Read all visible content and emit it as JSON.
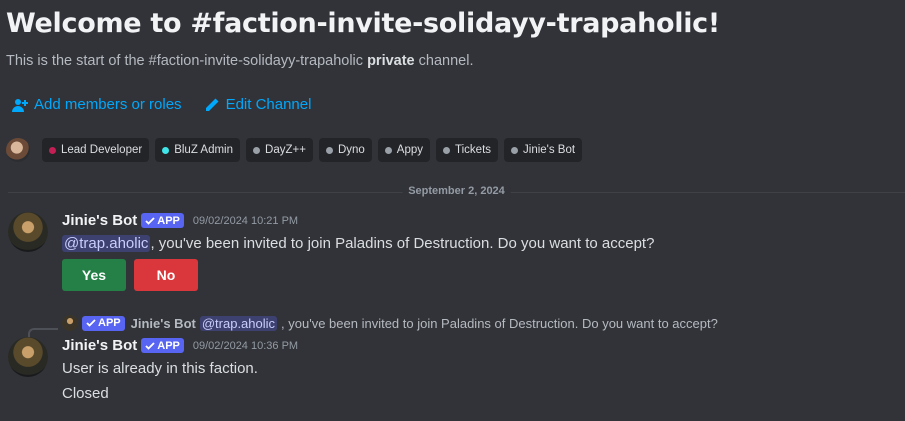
{
  "channel": {
    "welcome_title": "Welcome to #faction-invite-solidayy-trapaholic!",
    "sub_prefix": "This is the start of the #faction-invite-solidayy-trapaholic ",
    "sub_bold": "private",
    "sub_suffix": " channel."
  },
  "actions": {
    "add_members": "Add members or roles",
    "edit_channel": "Edit Channel"
  },
  "roles": [
    {
      "label": "Lead Developer",
      "color": "#c41f55"
    },
    {
      "label": "BluZ Admin",
      "color": "#3fe5e8"
    },
    {
      "label": "DayZ++",
      "color": "#9aa0a8"
    },
    {
      "label": "Dyno",
      "color": "#9aa0a8"
    },
    {
      "label": "Appy",
      "color": "#9aa0a8"
    },
    {
      "label": "Tickets",
      "color": "#9aa0a8"
    },
    {
      "label": "Jinie's Bot",
      "color": "#9aa0a8"
    }
  ],
  "date_divider": "September 2, 2024",
  "messages": [
    {
      "author": "Jinie's Bot",
      "app_tag": "APP",
      "timestamp": "09/02/2024 10:21 PM",
      "mention": "@trap.aholic",
      "text": ", you've been invited to join Paladins of Destruction. Do you want to accept?",
      "buttons": {
        "yes": "Yes",
        "no": "No"
      }
    },
    {
      "reply": {
        "app_tag": "APP",
        "author": "Jinie's Bot",
        "mention": "@trap.aholic",
        "text": ", you've been invited to join Paladins of Destruction. Do you want to accept?"
      },
      "author": "Jinie's Bot",
      "app_tag": "APP",
      "timestamp": "09/02/2024 10:36 PM",
      "text": "User is already in this faction.",
      "text2": "Closed"
    }
  ],
  "colors": {
    "background": "#313338",
    "link": "#00a8fc",
    "app_tag": "#5865f2",
    "yes_button": "#248046",
    "no_button": "#da373c"
  }
}
